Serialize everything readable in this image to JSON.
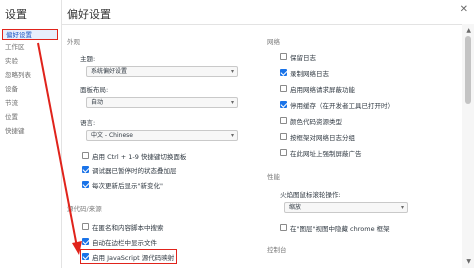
{
  "sidebar": {
    "title": "设置",
    "items": [
      {
        "label": "偏好设置",
        "active": true
      },
      {
        "label": "工作区"
      },
      {
        "label": "实验"
      },
      {
        "label": "忽略列表"
      },
      {
        "label": "设备"
      },
      {
        "label": "节流"
      },
      {
        "label": "位置"
      },
      {
        "label": "快捷键"
      }
    ]
  },
  "main": {
    "title": "偏好设置"
  },
  "appearance": {
    "section": "外观",
    "theme_label": "主题:",
    "theme_value": "系统偏好设置",
    "panel_layout_label": "面板布局:",
    "panel_layout_value": "自动",
    "language_label": "语言:",
    "language_value": "中文 - Chinese",
    "checkboxes": [
      {
        "label": "启用 Ctrl + 1-9 快捷键切换面板",
        "checked": false
      },
      {
        "label": "调试器已暂停时的状态叠加层",
        "checked": true
      },
      {
        "label": "每次更新后显示\"新变化\"",
        "checked": true
      }
    ]
  },
  "sources": {
    "section": "源代码/来源",
    "checkboxes": [
      {
        "label": "在匿名和内容脚本中搜索",
        "checked": false
      },
      {
        "label": "自动在边栏中显示文件",
        "checked": true
      },
      {
        "label": "启用 JavaScript 源代码映射",
        "checked": true
      }
    ]
  },
  "network": {
    "section": "网络",
    "checkboxes": [
      {
        "label": "保留日志",
        "checked": false
      },
      {
        "label": "录制网络日志",
        "checked": true
      },
      {
        "label": "启用网络请求屏蔽功能",
        "checked": false
      },
      {
        "label": "停用缓存（在开发者工具已打开时）",
        "checked": true
      },
      {
        "label": "颜色代码资源类型",
        "checked": false
      },
      {
        "label": "按框架对网络日志分组",
        "checked": false
      },
      {
        "label": "在此网址上强制屏蔽广告",
        "checked": false
      }
    ]
  },
  "performance": {
    "section": "性能",
    "flamechart_label": "火焰图鼠标滚轮操作:",
    "flamechart_value": "缩放",
    "checkboxes": [
      {
        "label": "在\"图层\"视图中隐藏 chrome 框架",
        "checked": false
      }
    ]
  },
  "console": {
    "section": "控制台"
  },
  "icons": {
    "close": "close-icon",
    "dropdown": "chevron-down-icon",
    "scroll_up": "scroll-up-icon",
    "scroll_down": "scroll-down-icon"
  },
  "colors": {
    "accent": "#1a73e8",
    "annotation": "#e0231b"
  }
}
